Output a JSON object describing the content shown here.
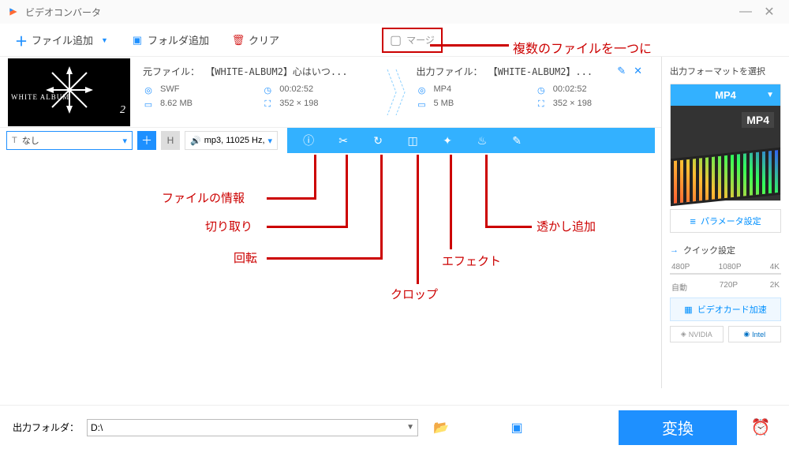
{
  "window": {
    "title": "ビデオコンバータ"
  },
  "toolbar": {
    "add_file": "ファイル追加",
    "add_folder": "フォルダ追加",
    "clear": "クリア",
    "merge": "マージ"
  },
  "annotations": {
    "merge": "複数のファイルを一つに",
    "info": "ファイルの情報",
    "trim": "切り取り",
    "rotate": "回転",
    "crop": "クロップ",
    "effect": "エフェクト",
    "watermark": "透かし追加"
  },
  "file_item": {
    "thumb_text": "WHITE ALBUM",
    "thumb_num": "2",
    "source": {
      "title": "元ファイル： 【WHITE-ALBUM2】心はいつ...",
      "format": "SWF",
      "duration": "00:02:52",
      "size": "8.62 MB",
      "resolution": "352 × 198"
    },
    "output": {
      "title": "出力ファイル： 【WHITE-ALBUM2】...",
      "format": "MP4",
      "duration": "00:02:52",
      "size": "5 MB",
      "resolution": "352 × 198"
    }
  },
  "option_bar": {
    "subtitle_prefix": "T",
    "subtitle_value": "なし",
    "h_label": "H",
    "audio_label": "mp3, 11025 Hz, "
  },
  "sidebar": {
    "header": "出力フォーマットを選択",
    "format": "MP4",
    "badge": "MP4",
    "param_btn": "パラメータ設定",
    "quick_header": "クイック設定",
    "res_row1": [
      "480P",
      "1080P",
      "4K"
    ],
    "res_row2": [
      "自動",
      "720P",
      "2K"
    ],
    "gpu_btn": "ビデオカード加速",
    "gpu_nvidia": "NVIDIA",
    "gpu_intel": "Intel"
  },
  "footer": {
    "label": "出力フォルダ：",
    "path": "D:\\",
    "convert": "変換"
  }
}
